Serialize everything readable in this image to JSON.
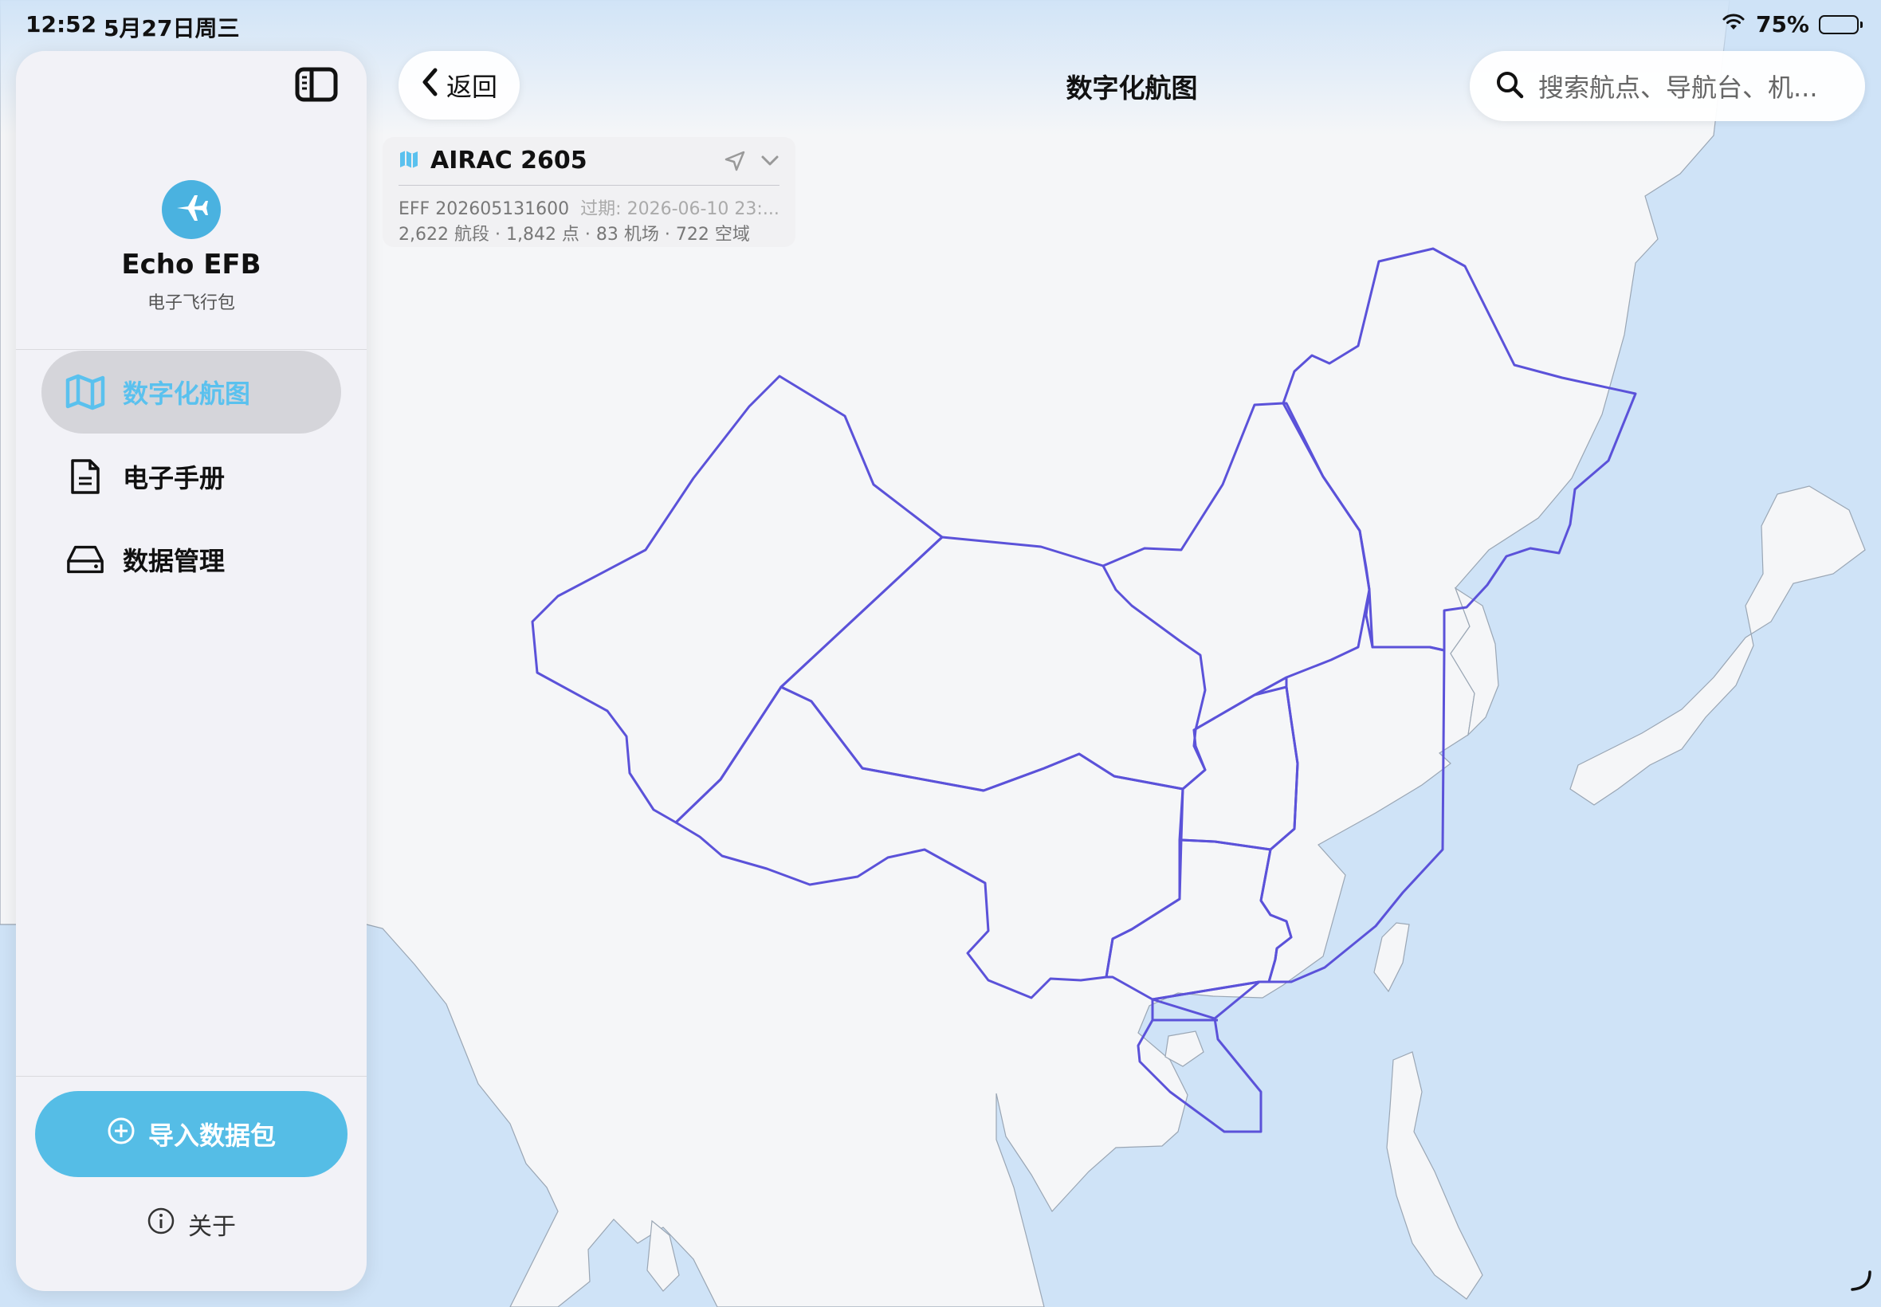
{
  "status_bar": {
    "time": "12:52",
    "date": "5月27日周三",
    "battery": "75%",
    "battery_level": 0.75
  },
  "sidebar": {
    "app_name": "Echo EFB",
    "app_subtitle": "电子飞行包",
    "items": [
      {
        "label": "数字化航图",
        "icon": "map-icon",
        "active": true
      },
      {
        "label": "电子手册",
        "icon": "document-icon",
        "active": false
      },
      {
        "label": "数据管理",
        "icon": "drive-icon",
        "active": false
      }
    ],
    "import_label": "导入数据包",
    "about_label": "关于"
  },
  "header": {
    "back_label": "返回",
    "title": "数字化航图",
    "search_placeholder": "搜索航点、导航台、机..."
  },
  "airac": {
    "title": "AIRAC 2605",
    "effective": "EFF 202605131600",
    "expiry": "过期: 2026-06-10 23:...",
    "stats": "2,622 航段 · 1,842 点 · 83 机场 · 722 空域"
  },
  "colors": {
    "accent": "#55bde6",
    "water": "#cfe3f7",
    "land": "#f5f6f8",
    "firBoundary": "#5b52d9",
    "activeText": "#5ac1ee"
  }
}
